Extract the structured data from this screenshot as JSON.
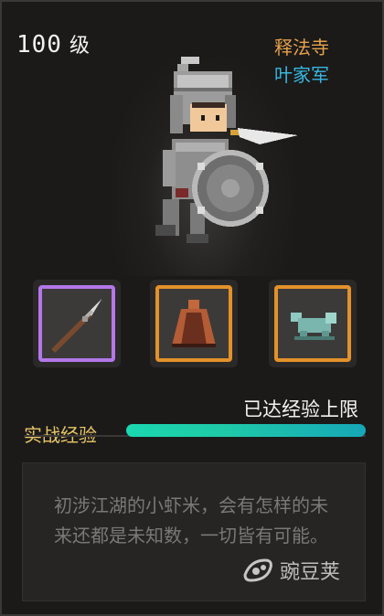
{
  "hero": {
    "level_value": "100",
    "level_unit": "级",
    "sect": "释法寺",
    "army": "叶家军"
  },
  "equipment": [
    {
      "name": "spear",
      "rarity_color": "#b377e9"
    },
    {
      "name": "cloak",
      "rarity_color": "#e3912a"
    },
    {
      "name": "jade-beast",
      "rarity_color": "#e3912a"
    }
  ],
  "experience": {
    "label": "实战经验",
    "status": "已达经验上限",
    "progress": 1.0
  },
  "description": "初涉江湖的小虾米，会有怎样的未来还都是未知数，一切皆有可能。",
  "watermark": "豌豆荚",
  "colors": {
    "exp_label": "#e8c766",
    "exp_bar": "#1ad8b0",
    "sect": "#e6a14b",
    "army": "#39b7e0"
  }
}
